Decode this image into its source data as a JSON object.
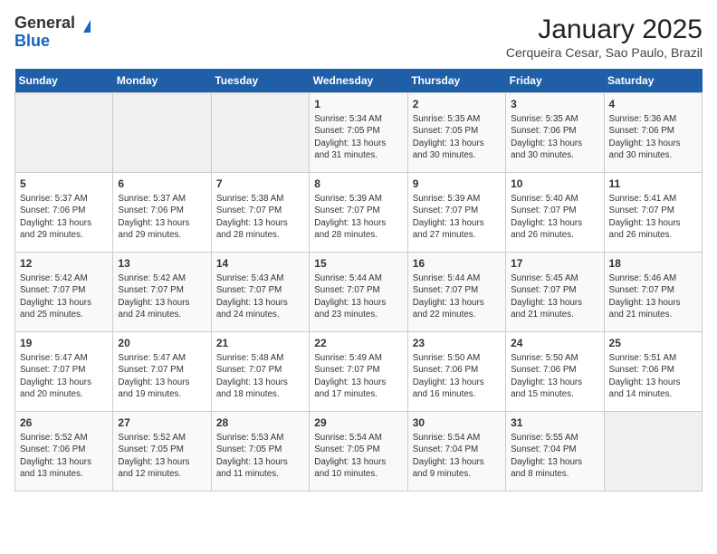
{
  "header": {
    "logo_general": "General",
    "logo_blue": "Blue",
    "title": "January 2025",
    "subtitle": "Cerqueira Cesar, Sao Paulo, Brazil"
  },
  "days_of_week": [
    "Sunday",
    "Monday",
    "Tuesday",
    "Wednesday",
    "Thursday",
    "Friday",
    "Saturday"
  ],
  "weeks": [
    [
      {
        "day": "",
        "info": ""
      },
      {
        "day": "",
        "info": ""
      },
      {
        "day": "",
        "info": ""
      },
      {
        "day": "1",
        "info": "Sunrise: 5:34 AM\nSunset: 7:05 PM\nDaylight: 13 hours\nand 31 minutes."
      },
      {
        "day": "2",
        "info": "Sunrise: 5:35 AM\nSunset: 7:05 PM\nDaylight: 13 hours\nand 30 minutes."
      },
      {
        "day": "3",
        "info": "Sunrise: 5:35 AM\nSunset: 7:06 PM\nDaylight: 13 hours\nand 30 minutes."
      },
      {
        "day": "4",
        "info": "Sunrise: 5:36 AM\nSunset: 7:06 PM\nDaylight: 13 hours\nand 30 minutes."
      }
    ],
    [
      {
        "day": "5",
        "info": "Sunrise: 5:37 AM\nSunset: 7:06 PM\nDaylight: 13 hours\nand 29 minutes."
      },
      {
        "day": "6",
        "info": "Sunrise: 5:37 AM\nSunset: 7:06 PM\nDaylight: 13 hours\nand 29 minutes."
      },
      {
        "day": "7",
        "info": "Sunrise: 5:38 AM\nSunset: 7:07 PM\nDaylight: 13 hours\nand 28 minutes."
      },
      {
        "day": "8",
        "info": "Sunrise: 5:39 AM\nSunset: 7:07 PM\nDaylight: 13 hours\nand 28 minutes."
      },
      {
        "day": "9",
        "info": "Sunrise: 5:39 AM\nSunset: 7:07 PM\nDaylight: 13 hours\nand 27 minutes."
      },
      {
        "day": "10",
        "info": "Sunrise: 5:40 AM\nSunset: 7:07 PM\nDaylight: 13 hours\nand 26 minutes."
      },
      {
        "day": "11",
        "info": "Sunrise: 5:41 AM\nSunset: 7:07 PM\nDaylight: 13 hours\nand 26 minutes."
      }
    ],
    [
      {
        "day": "12",
        "info": "Sunrise: 5:42 AM\nSunset: 7:07 PM\nDaylight: 13 hours\nand 25 minutes."
      },
      {
        "day": "13",
        "info": "Sunrise: 5:42 AM\nSunset: 7:07 PM\nDaylight: 13 hours\nand 24 minutes."
      },
      {
        "day": "14",
        "info": "Sunrise: 5:43 AM\nSunset: 7:07 PM\nDaylight: 13 hours\nand 24 minutes."
      },
      {
        "day": "15",
        "info": "Sunrise: 5:44 AM\nSunset: 7:07 PM\nDaylight: 13 hours\nand 23 minutes."
      },
      {
        "day": "16",
        "info": "Sunrise: 5:44 AM\nSunset: 7:07 PM\nDaylight: 13 hours\nand 22 minutes."
      },
      {
        "day": "17",
        "info": "Sunrise: 5:45 AM\nSunset: 7:07 PM\nDaylight: 13 hours\nand 21 minutes."
      },
      {
        "day": "18",
        "info": "Sunrise: 5:46 AM\nSunset: 7:07 PM\nDaylight: 13 hours\nand 21 minutes."
      }
    ],
    [
      {
        "day": "19",
        "info": "Sunrise: 5:47 AM\nSunset: 7:07 PM\nDaylight: 13 hours\nand 20 minutes."
      },
      {
        "day": "20",
        "info": "Sunrise: 5:47 AM\nSunset: 7:07 PM\nDaylight: 13 hours\nand 19 minutes."
      },
      {
        "day": "21",
        "info": "Sunrise: 5:48 AM\nSunset: 7:07 PM\nDaylight: 13 hours\nand 18 minutes."
      },
      {
        "day": "22",
        "info": "Sunrise: 5:49 AM\nSunset: 7:07 PM\nDaylight: 13 hours\nand 17 minutes."
      },
      {
        "day": "23",
        "info": "Sunrise: 5:50 AM\nSunset: 7:06 PM\nDaylight: 13 hours\nand 16 minutes."
      },
      {
        "day": "24",
        "info": "Sunrise: 5:50 AM\nSunset: 7:06 PM\nDaylight: 13 hours\nand 15 minutes."
      },
      {
        "day": "25",
        "info": "Sunrise: 5:51 AM\nSunset: 7:06 PM\nDaylight: 13 hours\nand 14 minutes."
      }
    ],
    [
      {
        "day": "26",
        "info": "Sunrise: 5:52 AM\nSunset: 7:06 PM\nDaylight: 13 hours\nand 13 minutes."
      },
      {
        "day": "27",
        "info": "Sunrise: 5:52 AM\nSunset: 7:05 PM\nDaylight: 13 hours\nand 12 minutes."
      },
      {
        "day": "28",
        "info": "Sunrise: 5:53 AM\nSunset: 7:05 PM\nDaylight: 13 hours\nand 11 minutes."
      },
      {
        "day": "29",
        "info": "Sunrise: 5:54 AM\nSunset: 7:05 PM\nDaylight: 13 hours\nand 10 minutes."
      },
      {
        "day": "30",
        "info": "Sunrise: 5:54 AM\nSunset: 7:04 PM\nDaylight: 13 hours\nand 9 minutes."
      },
      {
        "day": "31",
        "info": "Sunrise: 5:55 AM\nSunset: 7:04 PM\nDaylight: 13 hours\nand 8 minutes."
      },
      {
        "day": "",
        "info": ""
      }
    ]
  ]
}
